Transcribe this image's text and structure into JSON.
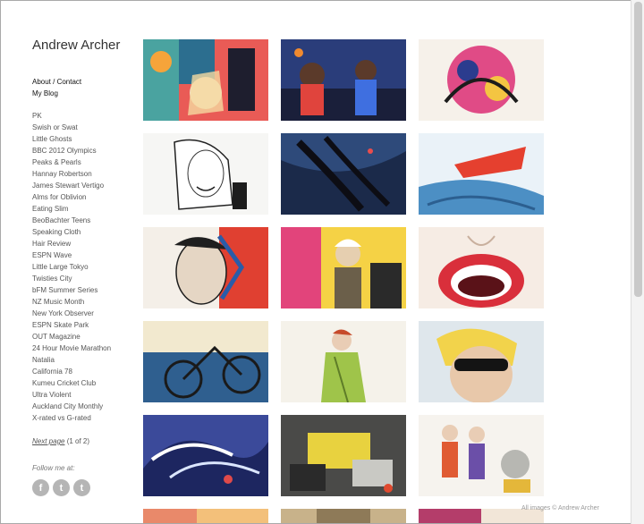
{
  "site": {
    "title": "Andrew Archer"
  },
  "nav": {
    "about": "About / Contact",
    "blog": "My Blog"
  },
  "projects": [
    "PK",
    "Swish or Swat",
    "Little Ghosts",
    "BBC 2012 Olympics",
    "Peaks & Pearls",
    "Hannay Robertson",
    "James Stewart Vertigo",
    "Alms for Oblivion",
    "Eating Slim",
    "BeoBachter Teens",
    "Speaking Cloth",
    "Hair Review",
    "ESPN Wave",
    "Little Large Tokyo",
    "Twisties City",
    "bFM Summer Series",
    "NZ Music Month",
    "New York Observer",
    "ESPN Skate Park",
    "OUT Magazine",
    "24 Hour Movie Marathon",
    "Natalia",
    "California 78",
    "Kumeu Cricket Club",
    "Ultra Violent",
    "Auckland City Monthly",
    "X-rated vs G-rated"
  ],
  "pager": {
    "next": "Next page",
    "count": "(1 of 2)"
  },
  "follow": {
    "label": "Follow me at:",
    "icons": [
      "facebook-icon",
      "twitter-icon",
      "tumblr-icon"
    ],
    "glyphs": [
      "f",
      "t",
      "t"
    ]
  },
  "footer": {
    "copyright": "All images © Andrew Archer"
  },
  "colors": {
    "text": "#333333",
    "link": "#555555",
    "social": "#b5b5b5"
  }
}
